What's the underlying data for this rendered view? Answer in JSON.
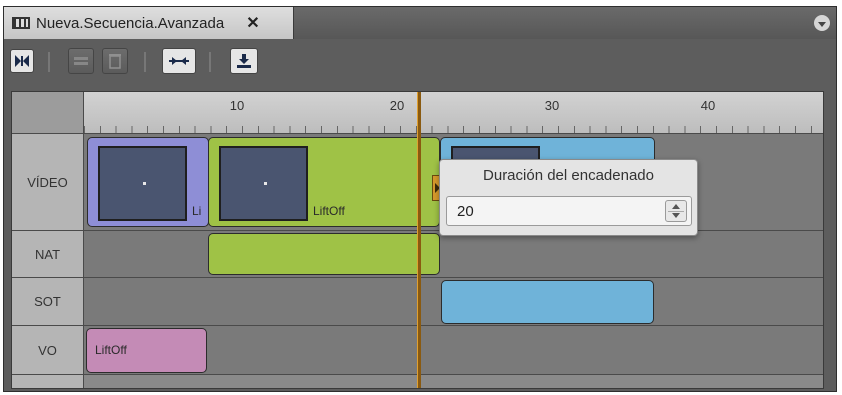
{
  "window": {
    "tab_title": "Nueva.Secuencia.Avanzada",
    "close_glyph": "✕"
  },
  "toolbar": {
    "buttons": [
      {
        "name": "sequence-icon",
        "enabled": true
      },
      {
        "name": "split-clip-icon",
        "enabled": false
      },
      {
        "name": "trash-icon",
        "enabled": false
      },
      {
        "name": "transition-icon",
        "enabled": true
      },
      {
        "name": "download-icon",
        "enabled": true
      }
    ]
  },
  "ruler": {
    "labels": [
      "10",
      "20",
      "30",
      "40"
    ]
  },
  "tracks": {
    "video": {
      "label": "VÍDEO"
    },
    "nat": {
      "label": "NAT"
    },
    "sot": {
      "label": "SOT"
    },
    "vo": {
      "label": "VO"
    }
  },
  "clips": {
    "video_1_label": "Li",
    "video_2_label": "LiftOff",
    "vo_1_label": "LiftOff"
  },
  "colors": {
    "video_clip_1": "#8e8ed6",
    "video_clip_2": "#9fc246",
    "nat_clip": "#9fc246",
    "sot_clip": "#6fb3d9",
    "vo_clip": "#c48bb6",
    "playhead": "#d69a2c"
  },
  "popup": {
    "title": "Duración del encadenado",
    "value": "20"
  }
}
